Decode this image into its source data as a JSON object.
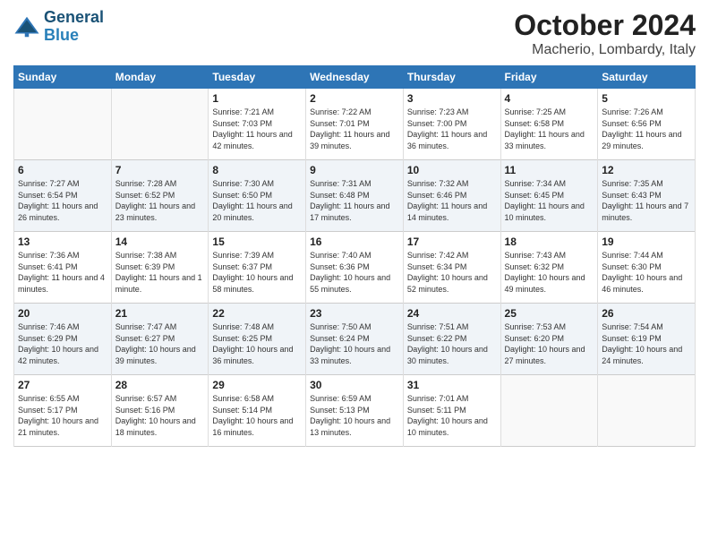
{
  "logo": {
    "line1": "General",
    "line2": "Blue"
  },
  "title": "October 2024",
  "location": "Macherio, Lombardy, Italy",
  "days_of_week": [
    "Sunday",
    "Monday",
    "Tuesday",
    "Wednesday",
    "Thursday",
    "Friday",
    "Saturday"
  ],
  "weeks": [
    [
      {
        "num": "",
        "sunrise": "",
        "sunset": "",
        "daylight": ""
      },
      {
        "num": "",
        "sunrise": "",
        "sunset": "",
        "daylight": ""
      },
      {
        "num": "1",
        "sunrise": "Sunrise: 7:21 AM",
        "sunset": "Sunset: 7:03 PM",
        "daylight": "Daylight: 11 hours and 42 minutes."
      },
      {
        "num": "2",
        "sunrise": "Sunrise: 7:22 AM",
        "sunset": "Sunset: 7:01 PM",
        "daylight": "Daylight: 11 hours and 39 minutes."
      },
      {
        "num": "3",
        "sunrise": "Sunrise: 7:23 AM",
        "sunset": "Sunset: 7:00 PM",
        "daylight": "Daylight: 11 hours and 36 minutes."
      },
      {
        "num": "4",
        "sunrise": "Sunrise: 7:25 AM",
        "sunset": "Sunset: 6:58 PM",
        "daylight": "Daylight: 11 hours and 33 minutes."
      },
      {
        "num": "5",
        "sunrise": "Sunrise: 7:26 AM",
        "sunset": "Sunset: 6:56 PM",
        "daylight": "Daylight: 11 hours and 29 minutes."
      }
    ],
    [
      {
        "num": "6",
        "sunrise": "Sunrise: 7:27 AM",
        "sunset": "Sunset: 6:54 PM",
        "daylight": "Daylight: 11 hours and 26 minutes."
      },
      {
        "num": "7",
        "sunrise": "Sunrise: 7:28 AM",
        "sunset": "Sunset: 6:52 PM",
        "daylight": "Daylight: 11 hours and 23 minutes."
      },
      {
        "num": "8",
        "sunrise": "Sunrise: 7:30 AM",
        "sunset": "Sunset: 6:50 PM",
        "daylight": "Daylight: 11 hours and 20 minutes."
      },
      {
        "num": "9",
        "sunrise": "Sunrise: 7:31 AM",
        "sunset": "Sunset: 6:48 PM",
        "daylight": "Daylight: 11 hours and 17 minutes."
      },
      {
        "num": "10",
        "sunrise": "Sunrise: 7:32 AM",
        "sunset": "Sunset: 6:46 PM",
        "daylight": "Daylight: 11 hours and 14 minutes."
      },
      {
        "num": "11",
        "sunrise": "Sunrise: 7:34 AM",
        "sunset": "Sunset: 6:45 PM",
        "daylight": "Daylight: 11 hours and 10 minutes."
      },
      {
        "num": "12",
        "sunrise": "Sunrise: 7:35 AM",
        "sunset": "Sunset: 6:43 PM",
        "daylight": "Daylight: 11 hours and 7 minutes."
      }
    ],
    [
      {
        "num": "13",
        "sunrise": "Sunrise: 7:36 AM",
        "sunset": "Sunset: 6:41 PM",
        "daylight": "Daylight: 11 hours and 4 minutes."
      },
      {
        "num": "14",
        "sunrise": "Sunrise: 7:38 AM",
        "sunset": "Sunset: 6:39 PM",
        "daylight": "Daylight: 11 hours and 1 minute."
      },
      {
        "num": "15",
        "sunrise": "Sunrise: 7:39 AM",
        "sunset": "Sunset: 6:37 PM",
        "daylight": "Daylight: 10 hours and 58 minutes."
      },
      {
        "num": "16",
        "sunrise": "Sunrise: 7:40 AM",
        "sunset": "Sunset: 6:36 PM",
        "daylight": "Daylight: 10 hours and 55 minutes."
      },
      {
        "num": "17",
        "sunrise": "Sunrise: 7:42 AM",
        "sunset": "Sunset: 6:34 PM",
        "daylight": "Daylight: 10 hours and 52 minutes."
      },
      {
        "num": "18",
        "sunrise": "Sunrise: 7:43 AM",
        "sunset": "Sunset: 6:32 PM",
        "daylight": "Daylight: 10 hours and 49 minutes."
      },
      {
        "num": "19",
        "sunrise": "Sunrise: 7:44 AM",
        "sunset": "Sunset: 6:30 PM",
        "daylight": "Daylight: 10 hours and 46 minutes."
      }
    ],
    [
      {
        "num": "20",
        "sunrise": "Sunrise: 7:46 AM",
        "sunset": "Sunset: 6:29 PM",
        "daylight": "Daylight: 10 hours and 42 minutes."
      },
      {
        "num": "21",
        "sunrise": "Sunrise: 7:47 AM",
        "sunset": "Sunset: 6:27 PM",
        "daylight": "Daylight: 10 hours and 39 minutes."
      },
      {
        "num": "22",
        "sunrise": "Sunrise: 7:48 AM",
        "sunset": "Sunset: 6:25 PM",
        "daylight": "Daylight: 10 hours and 36 minutes."
      },
      {
        "num": "23",
        "sunrise": "Sunrise: 7:50 AM",
        "sunset": "Sunset: 6:24 PM",
        "daylight": "Daylight: 10 hours and 33 minutes."
      },
      {
        "num": "24",
        "sunrise": "Sunrise: 7:51 AM",
        "sunset": "Sunset: 6:22 PM",
        "daylight": "Daylight: 10 hours and 30 minutes."
      },
      {
        "num": "25",
        "sunrise": "Sunrise: 7:53 AM",
        "sunset": "Sunset: 6:20 PM",
        "daylight": "Daylight: 10 hours and 27 minutes."
      },
      {
        "num": "26",
        "sunrise": "Sunrise: 7:54 AM",
        "sunset": "Sunset: 6:19 PM",
        "daylight": "Daylight: 10 hours and 24 minutes."
      }
    ],
    [
      {
        "num": "27",
        "sunrise": "Sunrise: 6:55 AM",
        "sunset": "Sunset: 5:17 PM",
        "daylight": "Daylight: 10 hours and 21 minutes."
      },
      {
        "num": "28",
        "sunrise": "Sunrise: 6:57 AM",
        "sunset": "Sunset: 5:16 PM",
        "daylight": "Daylight: 10 hours and 18 minutes."
      },
      {
        "num": "29",
        "sunrise": "Sunrise: 6:58 AM",
        "sunset": "Sunset: 5:14 PM",
        "daylight": "Daylight: 10 hours and 16 minutes."
      },
      {
        "num": "30",
        "sunrise": "Sunrise: 6:59 AM",
        "sunset": "Sunset: 5:13 PM",
        "daylight": "Daylight: 10 hours and 13 minutes."
      },
      {
        "num": "31",
        "sunrise": "Sunrise: 7:01 AM",
        "sunset": "Sunset: 5:11 PM",
        "daylight": "Daylight: 10 hours and 10 minutes."
      },
      {
        "num": "",
        "sunrise": "",
        "sunset": "",
        "daylight": ""
      },
      {
        "num": "",
        "sunrise": "",
        "sunset": "",
        "daylight": ""
      }
    ]
  ]
}
